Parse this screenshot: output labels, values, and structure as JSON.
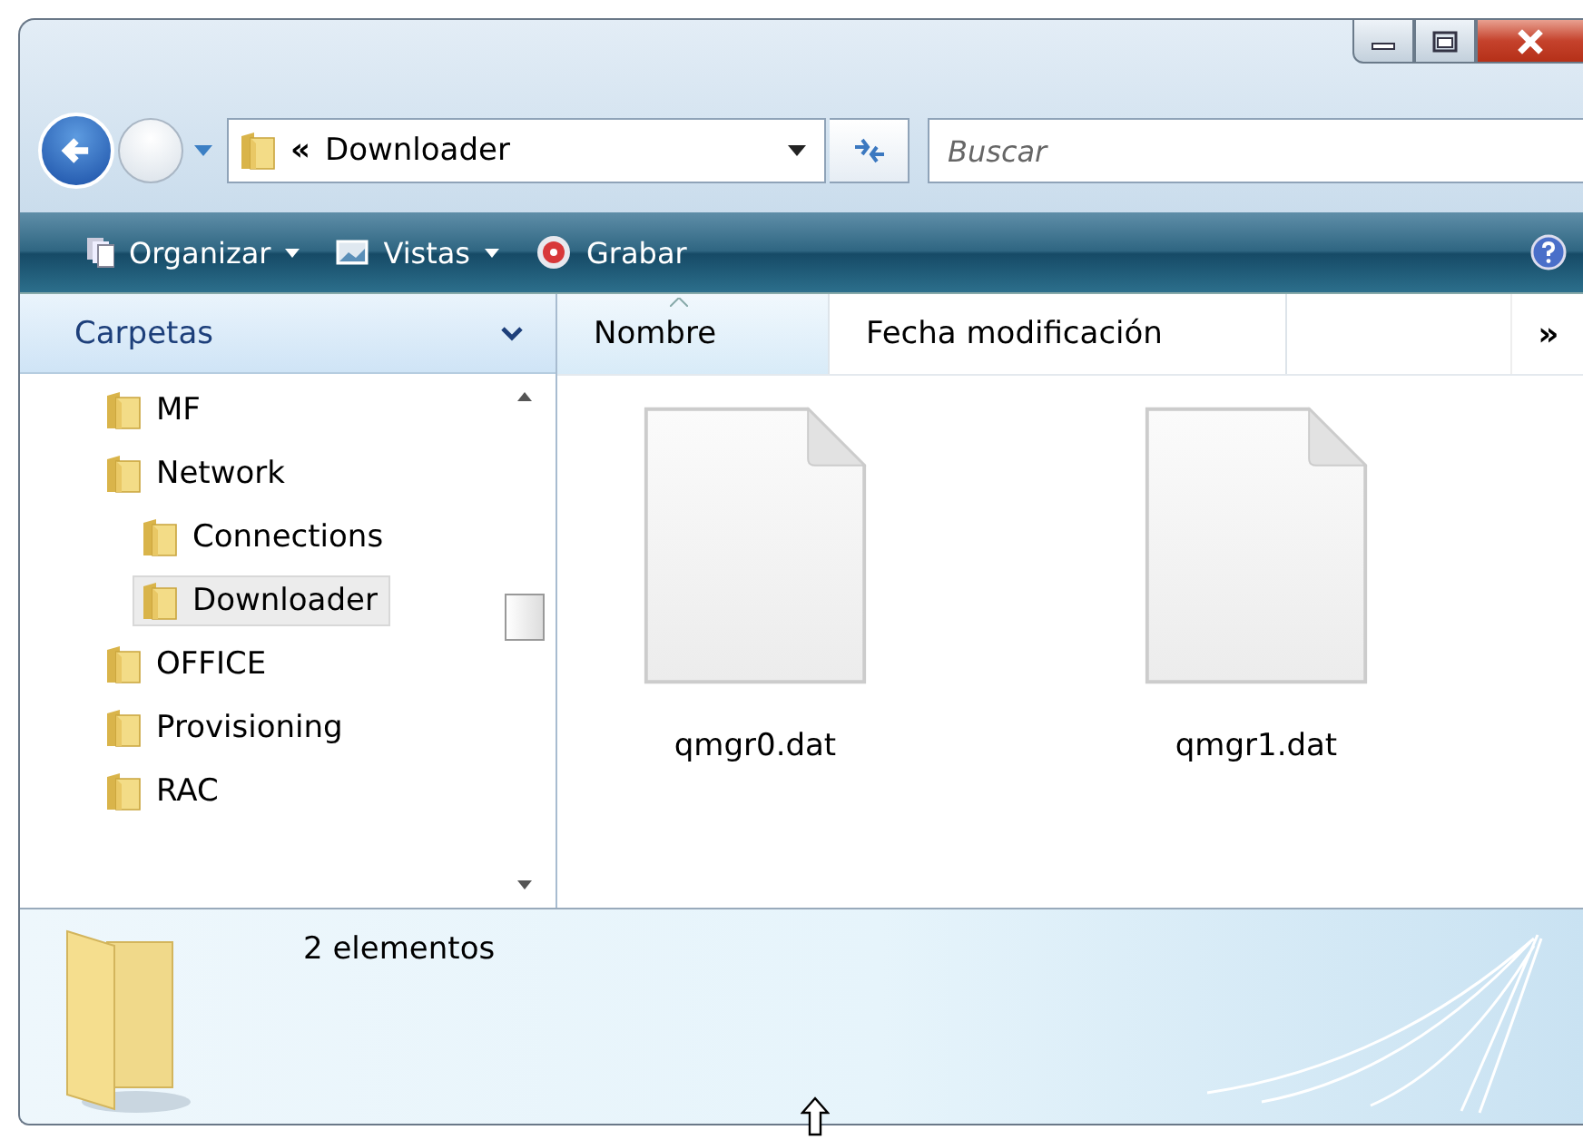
{
  "address": {
    "prefix": "«",
    "path": "Downloader"
  },
  "search": {
    "placeholder": "Buscar"
  },
  "toolbar": [
    {
      "label": "Organizar",
      "kind": "organize",
      "menu": true
    },
    {
      "label": "Vistas",
      "kind": "views",
      "menu": true
    },
    {
      "label": "Grabar",
      "kind": "burn",
      "menu": false
    }
  ],
  "sidebar": {
    "title": "Carpetas",
    "items": [
      {
        "label": "MF",
        "selected": false
      },
      {
        "label": "Network",
        "selected": false,
        "children": [
          {
            "label": "Connections",
            "selected": false
          },
          {
            "label": "Downloader",
            "selected": true
          }
        ]
      },
      {
        "label": "OFFICE",
        "selected": false
      },
      {
        "label": "Provisioning",
        "selected": false
      },
      {
        "label": "RAC",
        "selected": false
      }
    ]
  },
  "columns": [
    {
      "label": "Nombre",
      "sorted": true
    },
    {
      "label": "Fecha modificación",
      "sorted": false
    }
  ],
  "more_columns": "»",
  "files": [
    {
      "name": "qmgr0.dat"
    },
    {
      "name": "qmgr1.dat"
    }
  ],
  "details": {
    "count": "2 elementos"
  }
}
